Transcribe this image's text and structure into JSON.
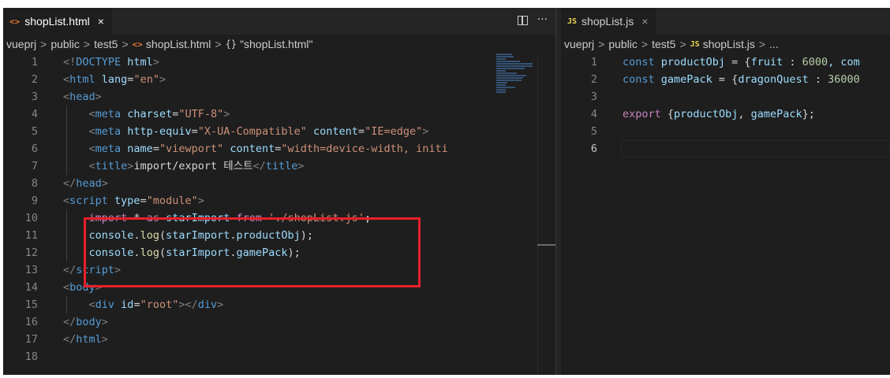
{
  "left_editor": {
    "tab": {
      "label": "shopList.html",
      "icon": "html-file-icon",
      "close": "×"
    },
    "actions": {
      "more": "···"
    },
    "breadcrumb": [
      "vueprj",
      "public",
      "test5",
      "shopList.html",
      "\"shopList.html\""
    ],
    "lines": [
      "1",
      "2",
      "3",
      "4",
      "5",
      "6",
      "7",
      "8",
      "9",
      "10",
      "11",
      "12",
      "13",
      "14",
      "15",
      "16",
      "17",
      "18"
    ]
  },
  "right_editor": {
    "tab": {
      "label": "shopList.js",
      "icon": "js-file-icon",
      "close": "×"
    },
    "breadcrumb": [
      "vueprj",
      "public",
      "test5",
      "shopList.js",
      "..."
    ],
    "lines": [
      "1",
      "2",
      "3",
      "4",
      "5",
      "6"
    ]
  },
  "glyphs": {
    "crumb_sep": ">",
    "html_icon": "<>",
    "js_icon": "JS",
    "obj_icon": "{}"
  },
  "code": {
    "l1": {
      "p1": "<!",
      "p2": "DOCTYPE",
      "p3": " html",
      "p4": ">"
    },
    "l2": {
      "p1": "<",
      "p2": "html",
      "p3": " lang",
      "p4": "=",
      "p5": "\"en\"",
      "p6": ">"
    },
    "l3": {
      "p1": "<",
      "p2": "head",
      "p3": ">"
    },
    "l4": {
      "p1": "<",
      "p2": "meta",
      "p3": " charset",
      "p4": "=",
      "p5": "\"UTF-8\"",
      "p6": ">"
    },
    "l5": {
      "p1": "<",
      "p2": "meta",
      "p3": " http-equiv",
      "p4": "=",
      "p5": "\"X-UA-Compatible\"",
      "p6": " content",
      "p7": "=",
      "p8": "\"IE=edge\"",
      "p9": ">"
    },
    "l6": {
      "p1": "<",
      "p2": "meta",
      "p3": " name",
      "p4": "=",
      "p5": "\"viewport\"",
      "p6": " content",
      "p7": "=",
      "p8": "\"width=device-width, initi"
    },
    "l7": {
      "p1": "<",
      "p2": "title",
      "p3": ">",
      "p4": "import/export 테스트",
      "p5": "</",
      "p6": "title",
      "p7": ">"
    },
    "l8": {
      "p1": "</",
      "p2": "head",
      "p3": ">"
    },
    "l9": {
      "p1": "<",
      "p2": "script",
      "p3": " type",
      "p4": "=",
      "p5": "\"module\"",
      "p6": ">"
    },
    "l10": {
      "p1": "import",
      "p2": " * ",
      "p3": "as",
      "p4": " starImport",
      "p5": " from",
      "p6": " './shopList.js'",
      "p7": ";"
    },
    "l11": {
      "p1": "console",
      "p2": ".",
      "p3": "log",
      "p4": "(",
      "p5": "starImport",
      "p6": ".",
      "p7": "productObj",
      "p8": ");"
    },
    "l12": {
      "p1": "console",
      "p2": ".",
      "p3": "log",
      "p4": "(",
      "p5": "starImport",
      "p6": ".",
      "p7": "gamePack",
      "p8": ");"
    },
    "l13": {
      "p1": "</",
      "p2": "script",
      "p3": ">"
    },
    "l14": {
      "p1": "<",
      "p2": "body",
      "p3": ">"
    },
    "l15": {
      "p1": "<",
      "p2": "div",
      "p3": " id",
      "p4": "=",
      "p5": "\"root\"",
      "p6": "></",
      "p7": "div",
      "p8": ">"
    },
    "l16": {
      "p1": "</",
      "p2": "body",
      "p3": ">"
    },
    "l17": {
      "p1": "</",
      "p2": "html",
      "p3": ">"
    },
    "r1": {
      "p1": "const",
      "p2": " productObj",
      "p3": " = {",
      "p4": "fruit",
      "p5": " : ",
      "p6": "6000",
      "p7": ", com"
    },
    "r2": {
      "p1": "const",
      "p2": " gamePack",
      "p3": " = {",
      "p4": "dragonQuest",
      "p5": " : ",
      "p6": "36000"
    },
    "r4": {
      "p1": "export",
      "p2": " {",
      "p3": "productObj",
      "p4": ", ",
      "p5": "gamePack",
      "p6": "};"
    }
  }
}
